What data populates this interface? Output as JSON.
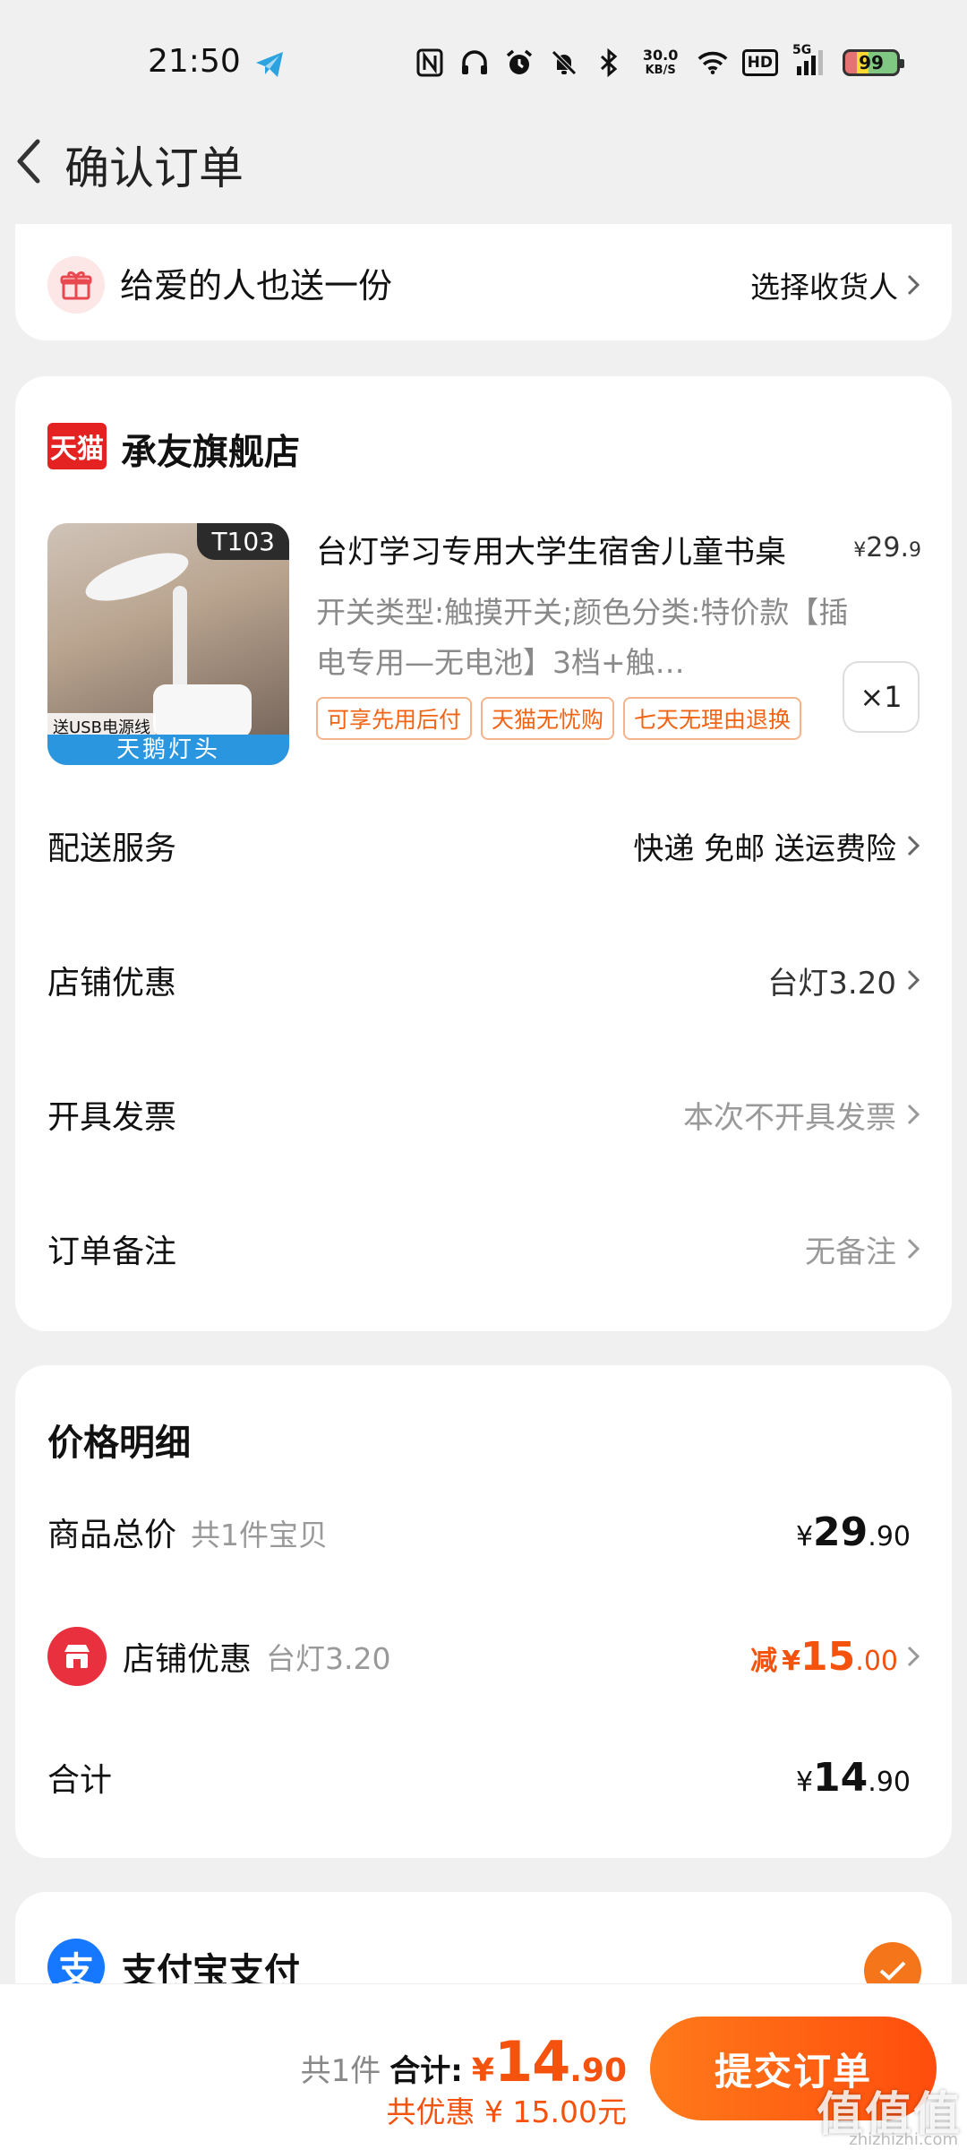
{
  "status_bar": {
    "time": "21:50",
    "net_speed_value": "30.0",
    "net_speed_unit": "KB/S",
    "hd": "HD",
    "signal_label": "5G",
    "battery": "99"
  },
  "header": {
    "title": "确认订单"
  },
  "gift": {
    "text": "给爱的人也送一份",
    "action": "选择收货人"
  },
  "shop": {
    "badge": "天猫",
    "name": "承友旗舰店",
    "product": {
      "image_badge": "T103",
      "image_caption_small": "送USB电源线",
      "image_caption": "天鹅灯头",
      "title": "台灯学习专用大学生宿舍儿童书桌",
      "price_symbol": "¥",
      "price_int": "29.",
      "price_dec": "9",
      "spec": "开关类型:触摸开关;颜色分类:特价款【插电专用—无电池】3档+触…",
      "qty": "×1",
      "tags": [
        "可享先用后付",
        "天猫无忧购",
        "七天无理由退换"
      ]
    },
    "rows": [
      {
        "label": "配送服务",
        "value": "快递 免邮 送运费险"
      },
      {
        "label": "店铺优惠",
        "value": "台灯3.20"
      },
      {
        "label": "开具发票",
        "value": "本次不开具发票"
      },
      {
        "label": "订单备注",
        "value": "无备注"
      }
    ]
  },
  "price_detail": {
    "title": "价格明细",
    "goods_label": "商品总价",
    "goods_sub": "共1件宝贝",
    "goods_int": "29",
    "goods_dec": ".90",
    "shop_label": "店铺优惠",
    "shop_sub": "台灯3.20",
    "discount_prefix": "减",
    "discount_int": "15",
    "discount_dec": ".00",
    "total_label": "合计",
    "total_int": "14",
    "total_dec": ".90",
    "yen": "¥"
  },
  "payment": {
    "name": "支付宝支付",
    "logo_char": "支"
  },
  "bottom": {
    "count": "共1件",
    "total_label": "合计:",
    "yen": "¥",
    "total_int": "14",
    "total_dec": ".90",
    "saved": "共优惠 ¥ 15.00元",
    "submit": "提交订单"
  },
  "watermark": {
    "main": "值值值",
    "sub": "zhizhizhi.com"
  },
  "colors": {
    "accent": "#f5520e",
    "button": "#ff5a10",
    "tmall_red": "#e52222",
    "alipay_blue": "#1677ff"
  }
}
